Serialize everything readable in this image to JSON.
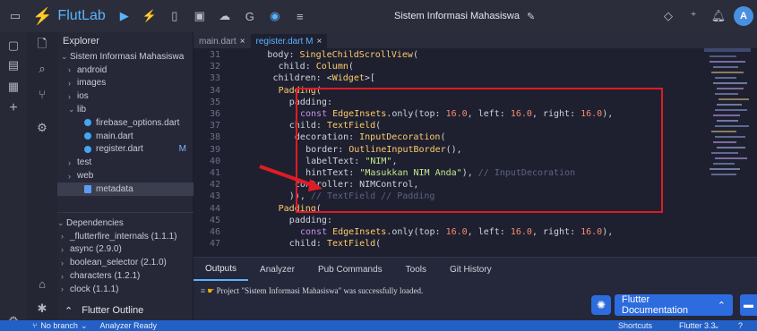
{
  "topbar": {
    "app_name": "FlutLab",
    "project_title": "Sistem Informasi Mahasiswa",
    "avatar_letter": "A"
  },
  "explorer": {
    "header": "Explorer",
    "tree": [
      {
        "label": "Sistem Informasi Mahasiswa",
        "chev": "⌄",
        "indent": 0,
        "kind": "folder"
      },
      {
        "label": "android",
        "chev": "›",
        "indent": 1,
        "kind": "folder"
      },
      {
        "label": "images",
        "chev": "›",
        "indent": 1,
        "kind": "folder"
      },
      {
        "label": "ios",
        "chev": "›",
        "indent": 1,
        "kind": "folder"
      },
      {
        "label": "lib",
        "chev": "⌄",
        "indent": 1,
        "kind": "folder"
      },
      {
        "label": "firebase_options.dart",
        "chev": "",
        "indent": 2,
        "kind": "dart"
      },
      {
        "label": "main.dart",
        "chev": "",
        "indent": 2,
        "kind": "dart"
      },
      {
        "label": "register.dart",
        "chev": "",
        "indent": 2,
        "kind": "dart",
        "badge": "M"
      },
      {
        "label": "test",
        "chev": "›",
        "indent": 1,
        "kind": "folder"
      },
      {
        "label": "web",
        "chev": "›",
        "indent": 1,
        "kind": "folder"
      },
      {
        "label": "metadata",
        "chev": "",
        "indent": 2,
        "kind": "meta"
      }
    ],
    "dependencies_header": "Dependencies",
    "dependencies": [
      "_flutterfire_internals (1.1.1)",
      "async (2.9.0)",
      "boolean_selector (2.1.0)",
      "characters (1.2.1)",
      "clock (1.1.1)"
    ],
    "outline_label": "Flutter Outline"
  },
  "tabs": [
    {
      "label": "main.dart",
      "active": false
    },
    {
      "label": "register.dart M",
      "active": true
    }
  ],
  "code_lines": [
    {
      "n": "31",
      "html": "<span class='plain'>body: </span><span class='fn'>SingleChildScrollView</span><span class='plain'>(</span>",
      "indent": 4
    },
    {
      "n": "32",
      "html": "<span class='plain'>child: </span><span class='fn'>Column</span><span class='plain'>(</span>",
      "indent": 6
    },
    {
      "n": "33",
      "html": "<span class='plain'>children: &lt;</span><span class='fn'>Widget</span><span class='plain'>&gt;[</span>",
      "indent": 5
    },
    {
      "n": "34",
      "html": "<span class='fn'>Padding</span><span class='plain'>(</span>",
      "indent": 6
    },
    {
      "n": "35",
      "html": "<span class='plain'>padding:</span>",
      "indent": 8
    },
    {
      "n": "36",
      "html": "<span class='kw'>const </span><span class='fn'>EdgeInsets</span><span class='plain'>.only(top: </span><span class='num'>16.0</span><span class='plain'>, left: </span><span class='num'>16.0</span><span class='plain'>, right: </span><span class='num'>16.0</span><span class='plain'>),</span>",
      "indent": 10
    },
    {
      "n": "37",
      "html": "<span class='plain'>child: </span><span class='fn'>TextField</span><span class='plain'>(</span>",
      "indent": 8
    },
    {
      "n": "38",
      "html": "<span class='plain'>decoration: </span><span class='fn'>InputDecoration</span><span class='plain'>(</span>",
      "indent": 9
    },
    {
      "n": "39",
      "html": "<span class='plain'>border: </span><span class='fn'>OutlineInputBorder</span><span class='plain'>(),</span>",
      "indent": 11
    },
    {
      "n": "40",
      "html": "<span class='plain'>labelText: </span><span class='str'>\"NIM\"</span><span class='plain'>,</span>",
      "indent": 11
    },
    {
      "n": "41",
      "html": "<span class='plain'>hintText: </span><span class='str'>\"Masukkan NIM Anda\"</span><span class='plain'>), </span><span class='cmt'>// InputDecoration</span>",
      "indent": 11
    },
    {
      "n": "42",
      "html": "<span class='plain'>controller: NIMControl,</span>",
      "indent": 9
    },
    {
      "n": "43",
      "html": "<span class='plain'>)), </span><span class='cmt'>// TextField // Padding</span>",
      "indent": 8
    },
    {
      "n": "44",
      "html": "<span class='fn'>Padding</span><span class='plain'>(</span>",
      "indent": 6
    },
    {
      "n": "45",
      "html": "<span class='plain'>padding:</span>",
      "indent": 8
    },
    {
      "n": "46",
      "html": "<span class='kw'>const </span><span class='fn'>EdgeInsets</span><span class='plain'>.only(top: </span><span class='num'>16.0</span><span class='plain'>, left: </span><span class='num'>16.0</span><span class='plain'>, right: </span><span class='num'>16.0</span><span class='plain'>),</span>",
      "indent": 10
    },
    {
      "n": "47",
      "html": "<span class='plain'>child: </span><span class='fn'>TextField</span><span class='plain'>(</span>",
      "indent": 8
    }
  ],
  "panel": {
    "tabs": [
      "Outputs",
      "Analyzer",
      "Pub Commands",
      "Tools",
      "Git History"
    ],
    "log": "Project \"Sistem Informasi Mahasiswa\" was successfully loaded.",
    "doc_button": "Flutter Documentation"
  },
  "status": {
    "branch": "No branch",
    "analyzer": "Analyzer Ready",
    "shortcuts": "Shortcuts",
    "flutter_version": "Flutter 3.3"
  },
  "colors": {
    "accent": "#5ab3ff",
    "highlight_box": "#e01b24",
    "statusbar": "#2260c6"
  }
}
